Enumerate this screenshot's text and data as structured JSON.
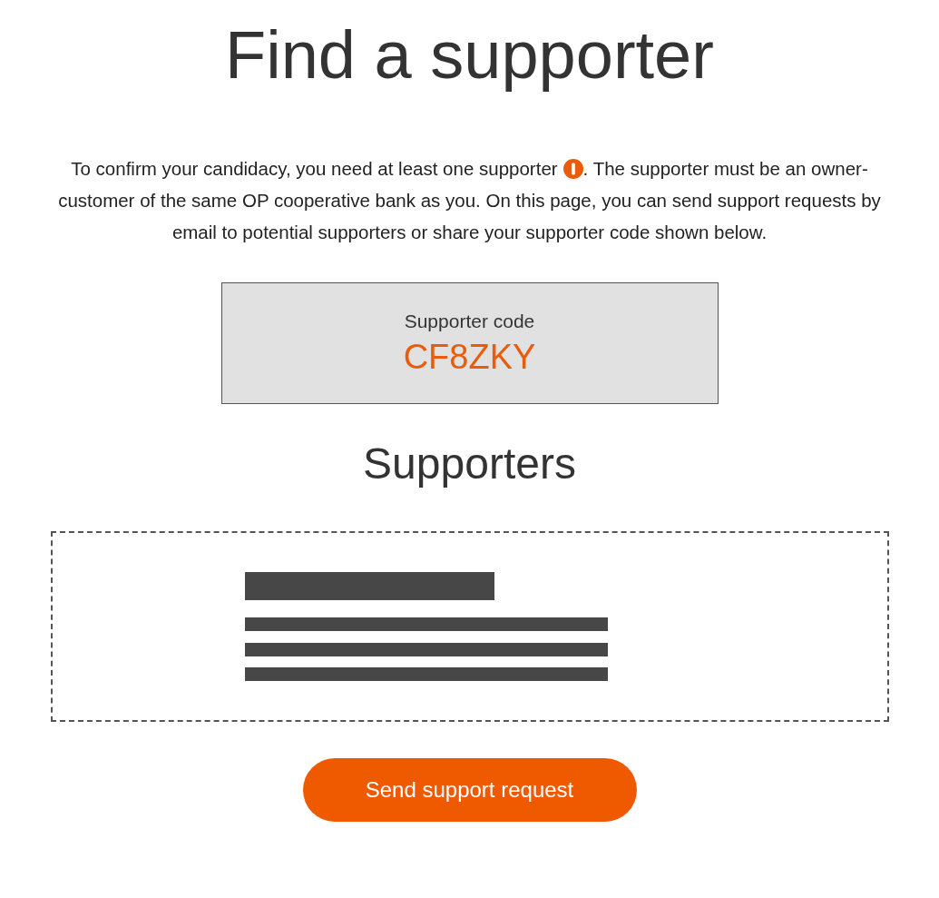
{
  "title": "Find a supporter",
  "intro": {
    "before_icon": "To confirm your candidacy, you need at least one supporter",
    "after_icon": ". The supporter must be an owner-customer of the same OP cooperative bank as you. On this page, you can send support requests by email to potential supporters or share your supporter code shown below."
  },
  "supporter_code": {
    "label": "Supporter code",
    "value": "CF8ZKY"
  },
  "supporters": {
    "heading": "Supporters"
  },
  "button": "Send support request"
}
